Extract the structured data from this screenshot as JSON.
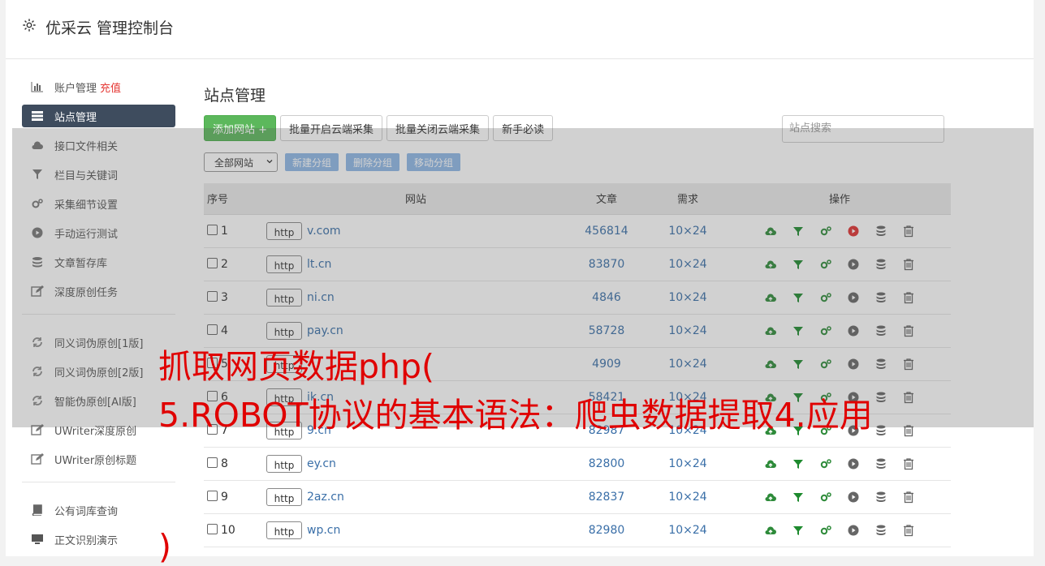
{
  "header": {
    "title": "优采云 管理控制台"
  },
  "sidebar": {
    "items": [
      {
        "label": "账户管理",
        "badge": "充值",
        "icon": "bar-chart-icon"
      },
      {
        "label": "站点管理",
        "icon": "server-icon",
        "active": true
      },
      {
        "label": "接口文件相关",
        "icon": "cloud-upload-icon"
      },
      {
        "label": "栏目与关键词",
        "icon": "filter-icon"
      },
      {
        "label": "采集细节设置",
        "icon": "gears-icon"
      },
      {
        "label": "手动运行测试",
        "icon": "play-circle-icon"
      },
      {
        "label": "文章暂存库",
        "icon": "database-icon"
      },
      {
        "label": "深度原创任务",
        "icon": "edit-icon"
      },
      {
        "label": "同义词伪原创[1版]",
        "icon": "refresh-icon"
      },
      {
        "label": "同义词伪原创[2版]",
        "icon": "refresh-icon"
      },
      {
        "label": "智能伪原创[AI版]",
        "icon": "refresh-icon"
      },
      {
        "label": "UWriter深度原创",
        "icon": "edit-icon"
      },
      {
        "label": "UWriter原创标题",
        "icon": "edit-icon"
      },
      {
        "label": "公有词库查询",
        "icon": "book-icon"
      },
      {
        "label": "正文识别演示",
        "icon": "monitor-icon"
      }
    ]
  },
  "main": {
    "title": "站点管理",
    "add_button": "添加网站 +",
    "batch_open": "批量开启云端采集",
    "batch_close": "批量关闭云端采集",
    "guide": "新手必读",
    "search_placeholder": "站点搜索",
    "group_select": "全部网站",
    "new_group": "新建分组",
    "delete_group": "删除分组",
    "move_group": "移动分组",
    "columns": [
      "序号",
      "网站",
      "文章",
      "需求",
      "操作"
    ],
    "rows": [
      {
        "no": "1",
        "proto": "http",
        "site": "v.com",
        "articles": "456814",
        "demand": "10×24"
      },
      {
        "no": "2",
        "proto": "http",
        "site": "lt.cn",
        "articles": "83870",
        "demand": "10×24"
      },
      {
        "no": "3",
        "proto": "http",
        "site": "ni.cn",
        "articles": "4846",
        "demand": "10×24"
      },
      {
        "no": "4",
        "proto": "http",
        "site": "pay.cn",
        "articles": "58728",
        "demand": "10×24"
      },
      {
        "no": "5",
        "proto": "http",
        "site": "",
        "articles": "4909",
        "demand": "10×24"
      },
      {
        "no": "6",
        "proto": "http",
        "site": "ik.cn",
        "articles": "58421",
        "demand": "10×24"
      },
      {
        "no": "7",
        "proto": "http",
        "site": "9.cn",
        "articles": "82987",
        "demand": "10×24"
      },
      {
        "no": "8",
        "proto": "http",
        "site": "ey.cn",
        "articles": "82800",
        "demand": "10×24"
      },
      {
        "no": "9",
        "proto": "http",
        "site": "2az.cn",
        "articles": "82837",
        "demand": "10×24"
      },
      {
        "no": "10",
        "proto": "http",
        "site": "wp.cn",
        "articles": "82980",
        "demand": "10×24"
      }
    ]
  },
  "caption": {
    "line1": "抓取网页数据php(",
    "line2": "5.ROBOT协议的基本语法：爬虫数据提取4.应用",
    "line3": ")"
  },
  "colors": {
    "accent_green": "#5cb85c",
    "active_nav": "#3e4c5e",
    "link_blue": "#3a6fa8",
    "caption_red": "#e00000"
  }
}
